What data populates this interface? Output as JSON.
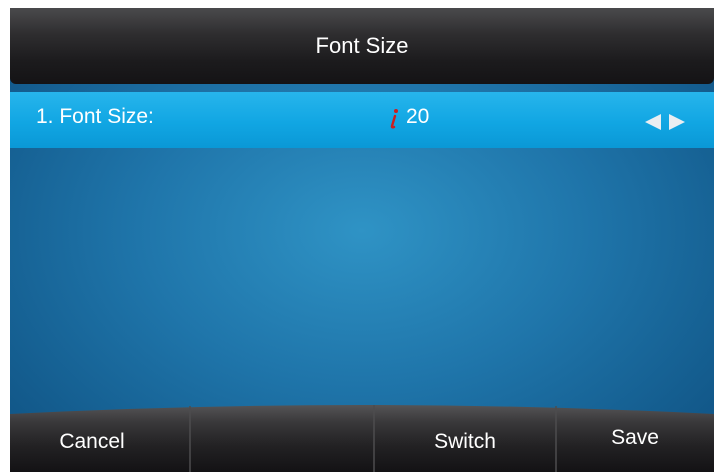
{
  "title": "Font Size",
  "items": [
    {
      "label": "1. Font Size:",
      "value": "20",
      "input_method_icon": "ime-indicator-icon",
      "selected": true
    }
  ],
  "arrows": {
    "left_icon": "arrow-left-icon",
    "right_icon": "arrow-right-icon"
  },
  "softkeys": [
    {
      "label": "Cancel"
    },
    {
      "label": ""
    },
    {
      "label": "Switch"
    },
    {
      "label": "Save"
    }
  ],
  "colors": {
    "highlight": "#11a6e3",
    "background": "#1f75aa",
    "title_bar": "#1c1b1d",
    "text": "#ffffff",
    "ime_icon": "#cc1f1f"
  }
}
